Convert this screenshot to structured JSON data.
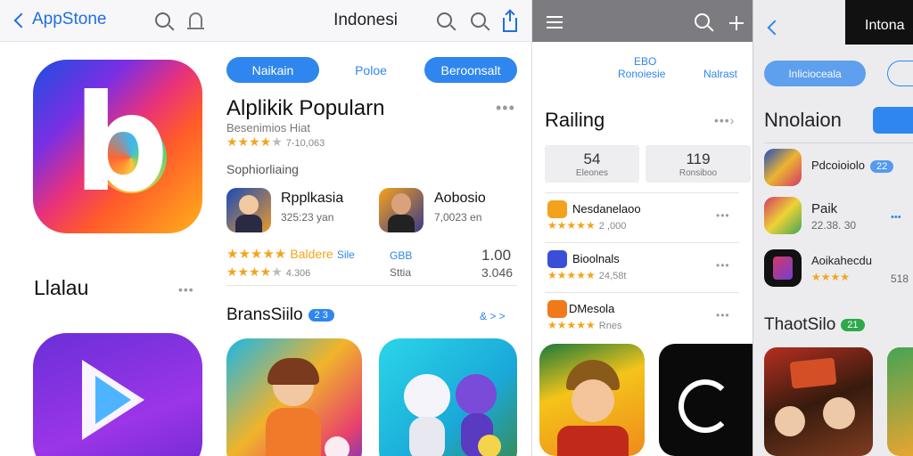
{
  "panel1": {
    "header": {
      "back_label": "AppStone",
      "title": "Indonesi"
    },
    "featured": {
      "pills": [
        "Naikain",
        "Poloe",
        "Beroonsalt"
      ],
      "title": "Alplikik Popularn",
      "subtitle": "Besenimios Hiat",
      "rating_meta": "7-10,063",
      "section_label": "Sophiorliaing",
      "apps": [
        {
          "name": "Rpplkasia",
          "meta": "325:23 yan"
        },
        {
          "name": "Aobosio",
          "meta": "7,0023 en"
        }
      ],
      "rating_row1": {
        "text": "Baldere",
        "link": "Sile",
        "tag": "GBB",
        "value": "1.00"
      },
      "rating_row2": {
        "meta": "4.306",
        "tag": "Sttia",
        "value": "3.046"
      }
    },
    "left_label": "Llalau",
    "section2": {
      "title": "BransSiilo",
      "badge": "2 3",
      "link": "& > >"
    }
  },
  "panel2": {
    "tabs": [
      "EBO",
      "Ronoiesie",
      "Nalrast"
    ],
    "title": "Railing",
    "stats": [
      {
        "num": "54",
        "caption": "Eleones"
      },
      {
        "num": "119",
        "caption": "Ronsiboo"
      }
    ],
    "items": [
      {
        "name": "Nesdanelaoo",
        "meta": "2 ,000",
        "color": "#f2a21c"
      },
      {
        "name": "Bioolnals",
        "meta": "24,58t",
        "color": "#3a4fd8"
      },
      {
        "name": "DMesola",
        "meta": "Rnes",
        "color": "#f07a1a"
      }
    ]
  },
  "panel3": {
    "header_title": "Intona",
    "pill": "Inlicioceala",
    "title": "Nnolaion",
    "items": [
      {
        "name": "Pdcoioiolo",
        "badge": "22",
        "meta": ""
      },
      {
        "name": "Paik",
        "meta": "22.38. 30",
        "value": ""
      },
      {
        "name": "Aoikahecdu",
        "meta": "",
        "value": "518"
      }
    ],
    "section_title": "ThaotSilo",
    "section_badge": "21"
  },
  "colors": {
    "accent": "#2f86ee",
    "star": "#f4a41c"
  }
}
